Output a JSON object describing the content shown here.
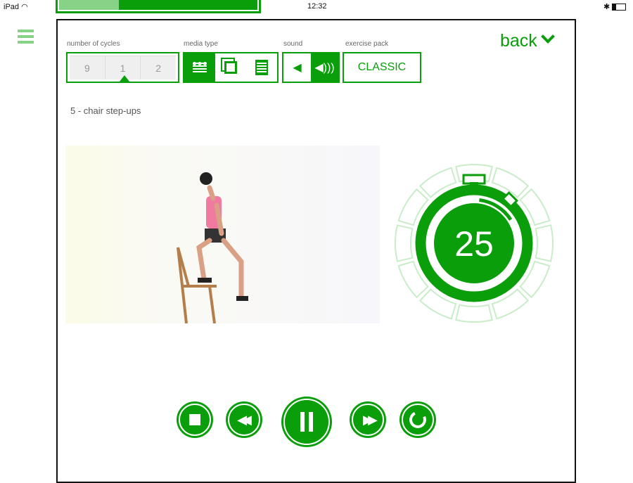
{
  "status_bar": {
    "device": "iPad",
    "time": "12:32"
  },
  "progress": {
    "fraction": 0.3
  },
  "header": {
    "back_label": "back"
  },
  "cycles": {
    "label": "number of cycles",
    "options": [
      "9",
      "1",
      "2"
    ],
    "selected": "1"
  },
  "media_type": {
    "label": "media type",
    "options": [
      "video-icon",
      "gallery-icon",
      "notes-icon"
    ],
    "selected": "video-icon"
  },
  "sound": {
    "label": "sound",
    "options": [
      "sound-off-icon",
      "sound-on-icon"
    ],
    "selected": "sound-on-icon"
  },
  "exercise_pack": {
    "label": "exercise pack",
    "value": "CLASSIC"
  },
  "exercise": {
    "title": "5 - chair step-ups"
  },
  "timer": {
    "seconds": "25",
    "segments_total": 12
  },
  "colors": {
    "accent": "#0a9e0a",
    "light": "#86d286",
    "ring": "#c9ecc9"
  }
}
